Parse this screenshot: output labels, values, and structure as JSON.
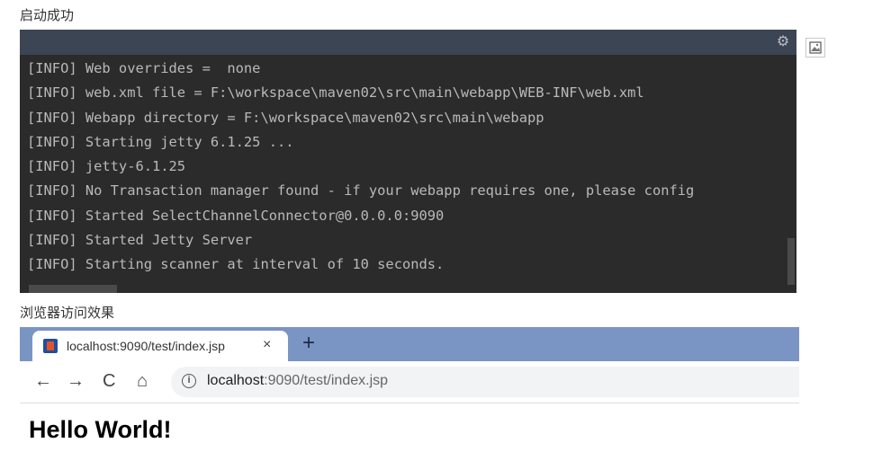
{
  "captions": {
    "startup_success": "启动成功",
    "browser_effect": "浏览器访问效果"
  },
  "console": {
    "gear_icon": "gear-icon",
    "lines": [
      "[INFO] Web overrides =  none",
      "[INFO] web.xml file = F:\\workspace\\maven02\\src\\main\\webapp\\WEB-INF\\web.xml",
      "[INFO] Webapp directory = F:\\workspace\\maven02\\src\\main\\webapp",
      "[INFO] Starting jetty 6.1.25 ...",
      "[INFO] jetty-6.1.25",
      "[INFO] No Transaction manager found - if your webapp requires one, please config",
      "[INFO] Started SelectChannelConnector@0.0.0.0:9090",
      "[INFO] Started Jetty Server",
      "[INFO] Starting scanner at interval of 10 seconds."
    ]
  },
  "browser": {
    "tab": {
      "title": "localhost:9090/test/index.jsp",
      "close": "×"
    },
    "new_tab": "+",
    "nav": {
      "back": "←",
      "forward": "→",
      "reload": "C",
      "home": "⌂"
    },
    "address": {
      "host": "localhost",
      "path": ":9090/test/index.jsp"
    },
    "page": {
      "heading": "Hello World!"
    }
  },
  "colors": {
    "console_bg": "#2b2b2b",
    "console_bar": "#3c4553",
    "tabstrip": "#7a95c4"
  }
}
